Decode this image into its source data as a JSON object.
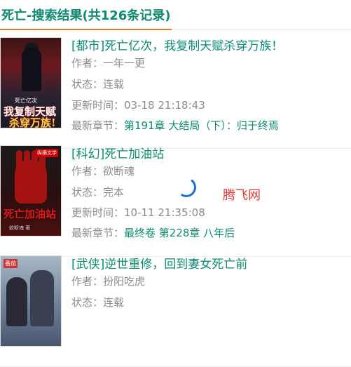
{
  "header": {
    "title": "死亡-搜索结果(共126条记录)"
  },
  "colors": {
    "accent": "#0e8a73",
    "underline": "#e07a2e",
    "muted": "#8c8c8c",
    "watermark": "#e23b3b",
    "spinner": "#1a6fd6"
  },
  "books": [
    {
      "title": "[都市]死亡亿次，我复制天赋杀穿万族！",
      "author_label": "作者：",
      "author": "一年一更",
      "status_label": "状态：",
      "status": "连载",
      "updated_label": "更新时间：",
      "updated": "03-18 21:18:43",
      "latest_label": "最新章节：",
      "latest": "第191章 大结局（下）：归于终焉",
      "cover_text": [
        "死亡亿次",
        "我复制天赋",
        "杀穿万族!"
      ]
    },
    {
      "title": "[科幻]死亡加油站",
      "author_label": "作者：",
      "author": "欲断魂",
      "status_label": "状态：",
      "status": "完本",
      "updated_label": "更新时间：",
      "updated": "10-11 21:35:08",
      "latest_label": "最新章节：",
      "latest": "最终卷 第228章 八年后",
      "cover_text": [
        "纵横文学",
        "死亡加油站",
        "欲断魂 著"
      ]
    },
    {
      "title": "[武侠]逆世重修，回到妻女死亡前",
      "author_label": "作者：",
      "author": "扮阳吃虎",
      "status_label": "状态：",
      "status": "连载",
      "cover_text": [
        "番茄"
      ]
    }
  ],
  "watermark": "腾飞网"
}
